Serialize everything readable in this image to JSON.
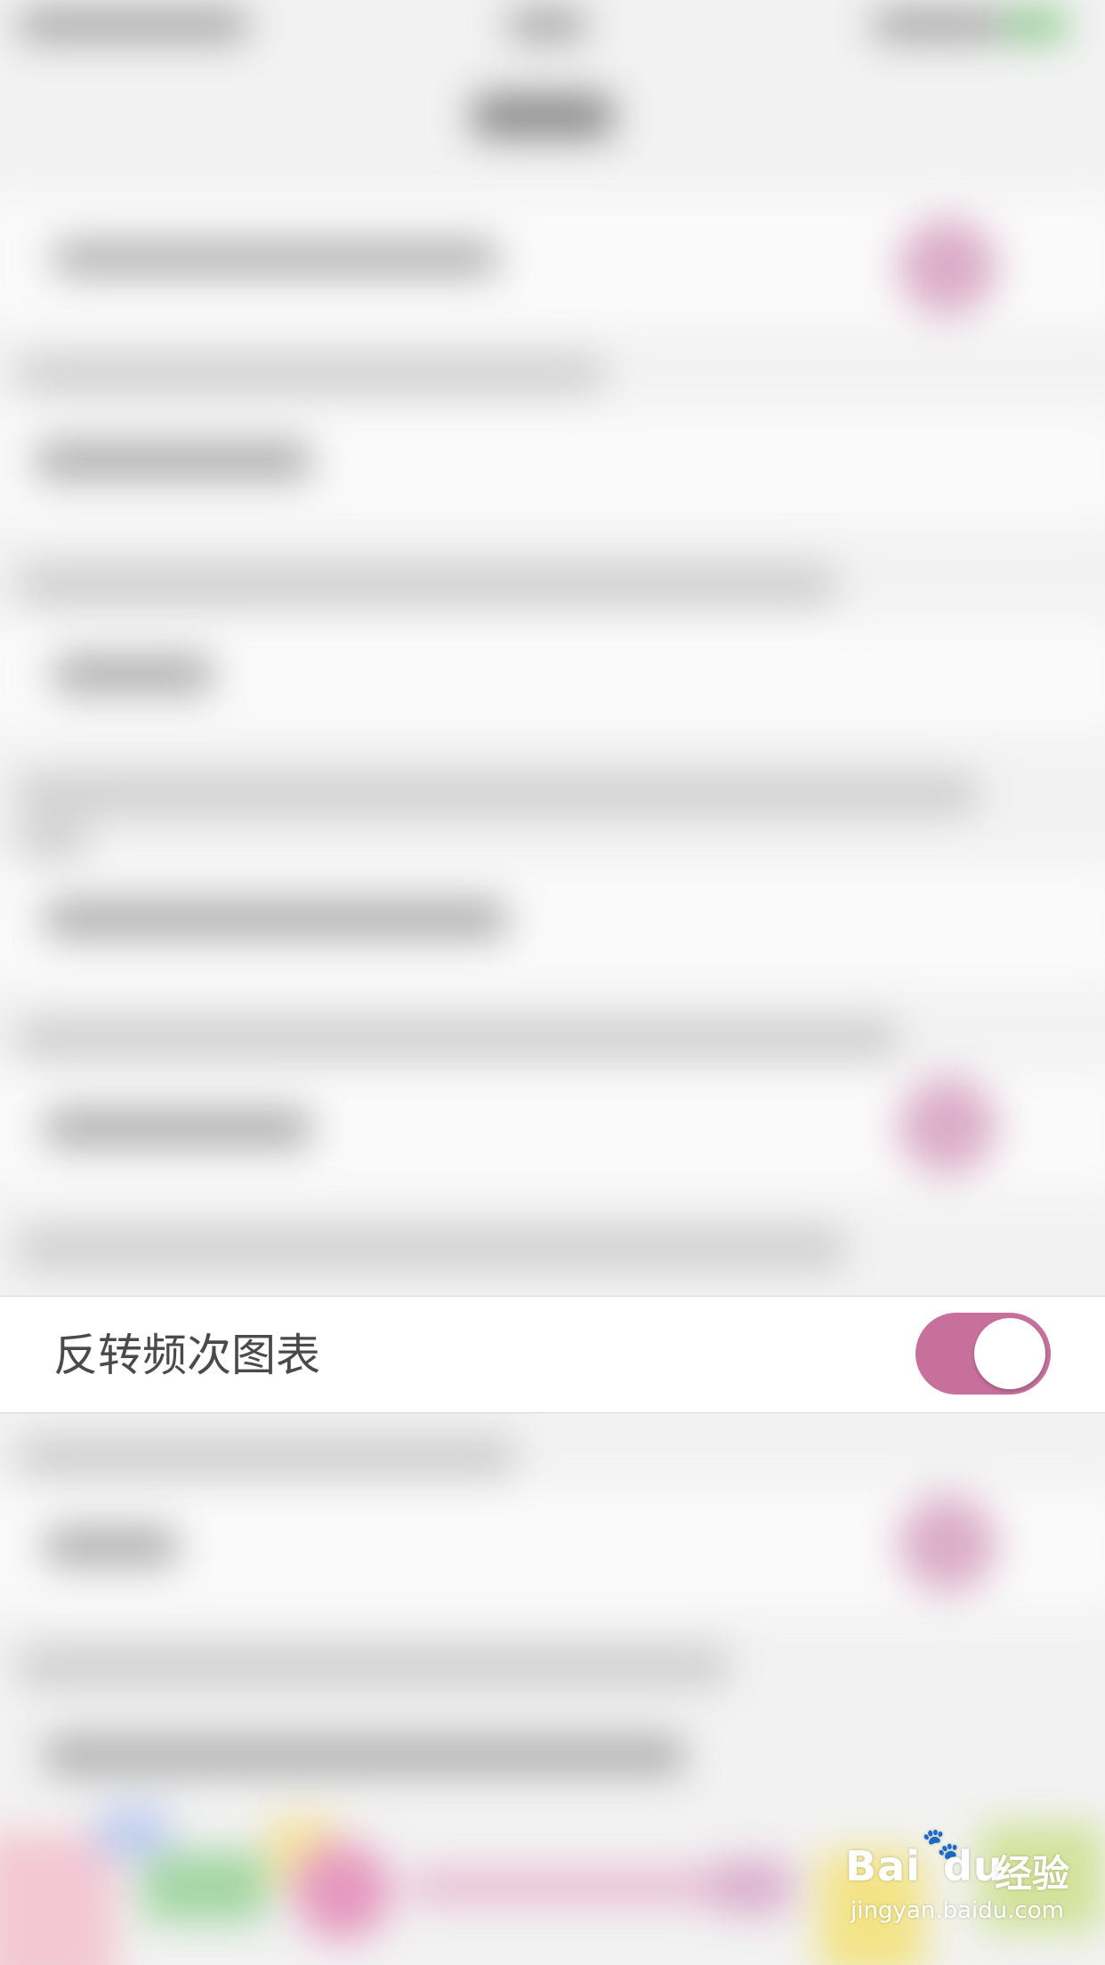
{
  "setting_row": {
    "label": "反转频次图表",
    "toggle_state": "on"
  },
  "watermark": {
    "logo_text": "Bai",
    "logo_suffix": "du",
    "brand_cn": "经验",
    "url": "jingyan.baidu.com"
  },
  "colors": {
    "accent_pink": "#c8709c",
    "row_background": "#ffffff",
    "label_text": "#4a4a4a",
    "background_blur": "#f2f2f2"
  }
}
